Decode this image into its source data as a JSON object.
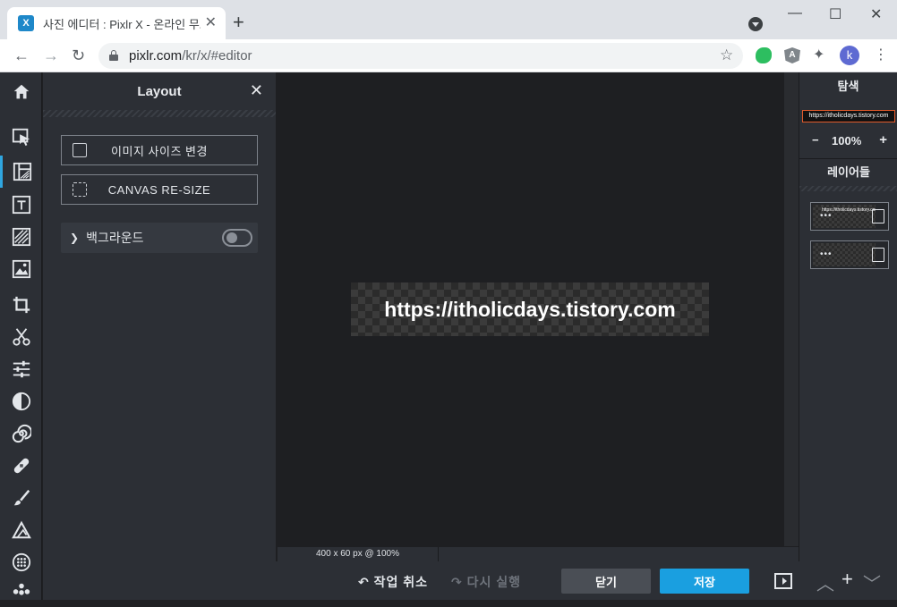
{
  "browser": {
    "tab_title": "사진 에디터 : Pixlr X - 온라인 무료 사진 편집기",
    "favicon_label": "X",
    "newtab_label": "+",
    "tab_close": "✕",
    "window": {
      "minimize": "—",
      "maximize": "☐",
      "close": "✕"
    },
    "nav": {
      "back": "←",
      "forward": "→",
      "reload": "↻"
    },
    "url_host": "pixlr.com",
    "url_path": "/kr/x/#editor",
    "star": "☆",
    "puzzle": "✦",
    "profile_initial": "k",
    "menu": "⋮",
    "angular_label": "A"
  },
  "app": {
    "left_panel": {
      "title": "Layout",
      "close": "✕",
      "buttons": [
        {
          "label": "이미지 사이즈 변경",
          "icon": "resize-icon"
        },
        {
          "label": "CANVAS RE-SIZE",
          "icon": "canvas-resize-icon"
        }
      ],
      "background_row": {
        "chevron": "❯",
        "label": "백그라운드",
        "toggle_on": false
      }
    },
    "canvas": {
      "text": "https://itholicdays.tistory.com",
      "status": "400 x 60 px @ 100%"
    },
    "right_panel": {
      "navigator_title": "탐색",
      "navigator_text": "https://itholicdays.tistory.com",
      "zoom": {
        "minus": "−",
        "value": "100%",
        "plus": "+"
      },
      "layers_title": "레이어들",
      "layers": [
        {
          "dots": "•••",
          "thumb_text": "https://itholicdays.tistory.com",
          "icon": "text-layer-icon"
        },
        {
          "dots": "•••",
          "thumb_text": "",
          "icon": "image-layer-icon"
        }
      ]
    },
    "bottom": {
      "undo": "↶ 작업 취소",
      "redo": "↷ 다시 실행",
      "close": "닫기",
      "save": "저장",
      "up": "︿",
      "add": "+",
      "down": "﹀"
    },
    "tools": [
      "home",
      "arrange",
      "layout",
      "text",
      "element",
      "image",
      "crop",
      "cutout",
      "adjust",
      "filter",
      "effect",
      "retouch",
      "draw",
      "shape",
      "pattern",
      "more"
    ]
  }
}
